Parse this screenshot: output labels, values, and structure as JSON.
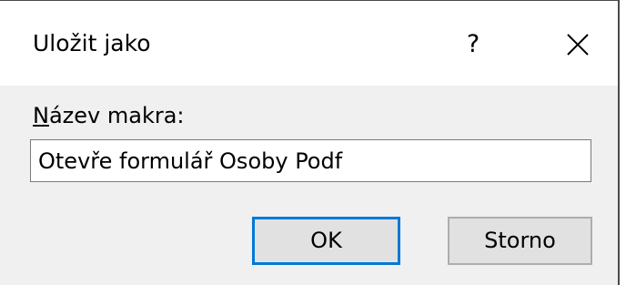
{
  "dialog": {
    "title": "Uložit jako",
    "help_label": "?",
    "close_icon": "close-icon"
  },
  "form": {
    "label_access_key": "N",
    "label_rest": "ázev makra:",
    "input_value": "Otevře formulář Osoby Podf"
  },
  "buttons": {
    "ok_label": "OK",
    "cancel_label": "Storno"
  },
  "colors": {
    "accent": "#0078d7",
    "dialog_background": "#f0f0f0",
    "titlebar_background": "#ffffff",
    "button_face": "#e1e1e1"
  }
}
